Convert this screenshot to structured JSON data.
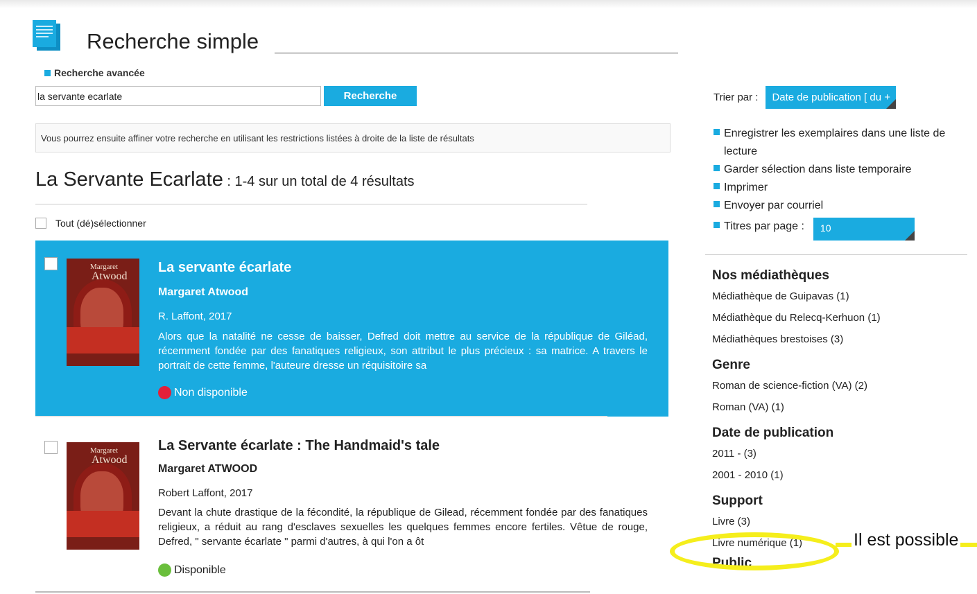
{
  "header": {
    "page_title": "Recherche simple",
    "advanced_link": "Recherche avancée"
  },
  "search": {
    "query": "la servante ecarlate",
    "button_label": "Recherche",
    "info_text": "Vous pourrez ensuite affiner votre recherche en utilisant les restrictions listées à droite de la liste de résultats"
  },
  "results": {
    "heading": "La Servante Ecarlate",
    "count_text": " : 1-4 sur un total de 4 résultats",
    "select_all_label": "Tout (dé)sélectionner",
    "items": [
      {
        "title": "La servante écarlate",
        "author": "Margaret Atwood",
        "publisher": "R. Laffont, 2017",
        "description": "Alors que la natalité ne cesse de baisser, Defred doit mettre au service de la république de Giléad, récemment fondée par des fanatiques religieux, son attribut le plus précieux : sa matrice. A travers le portrait de cette femme, l'auteure dresse un réquisitoire sa",
        "availability": "Non disponible",
        "cover_author_first": "Margaret",
        "cover_author_last": "Atwood"
      },
      {
        "title": "La Servante écarlate : The Handmaid's tale",
        "author": "Margaret ATWOOD",
        "publisher": "Robert Laffont, 2017",
        "description": "Devant la chute drastique de la fécondité, la république de Gilead, récemment fondée par des fanatiques religieux, a réduit au rang d'esclaves sexuelles les quelques femmes encore fertiles. Vêtue de rouge, Defred, \" servante écarlate \" parmi d'autres, à qui l'on a ôt",
        "availability": "Disponible",
        "cover_author_first": "Margaret",
        "cover_author_last": "Atwood"
      }
    ]
  },
  "sidebar": {
    "sort_label": "Trier par :",
    "sort_value": "Date de publication [ du +",
    "actions": [
      "Enregistrer les exemplaires dans une liste de lecture",
      "Garder sélection dans liste temporaire",
      "Imprimer",
      "Envoyer par courriel"
    ],
    "per_page_label": "Titres par page :",
    "per_page_value": "10",
    "facets": {
      "mediatheques": {
        "heading": "Nos médiathèques",
        "items": [
          "Médiathèque de Guipavas (1)",
          "Médiathèque du Relecq-Kerhuon (1)",
          "Médiathèques brestoises (3)"
        ]
      },
      "genre": {
        "heading": "Genre",
        "items": [
          "Roman de science-fiction (VA) (2)",
          "Roman (VA) (1)"
        ]
      },
      "date": {
        "heading": "Date de publication",
        "items": [
          "2011 - (3)",
          "2001 - 2010 (1)"
        ]
      },
      "support": {
        "heading": "Support",
        "items": [
          "Livre (3)",
          "Livre numérique (1)"
        ]
      },
      "public": {
        "heading": "Public"
      }
    }
  },
  "annotation": {
    "text": "Il est possible"
  },
  "colors": {
    "accent": "#1aabe0",
    "highlight": "#f5ee1c",
    "unavailable": "#e3203a",
    "available": "#6abf3c"
  }
}
